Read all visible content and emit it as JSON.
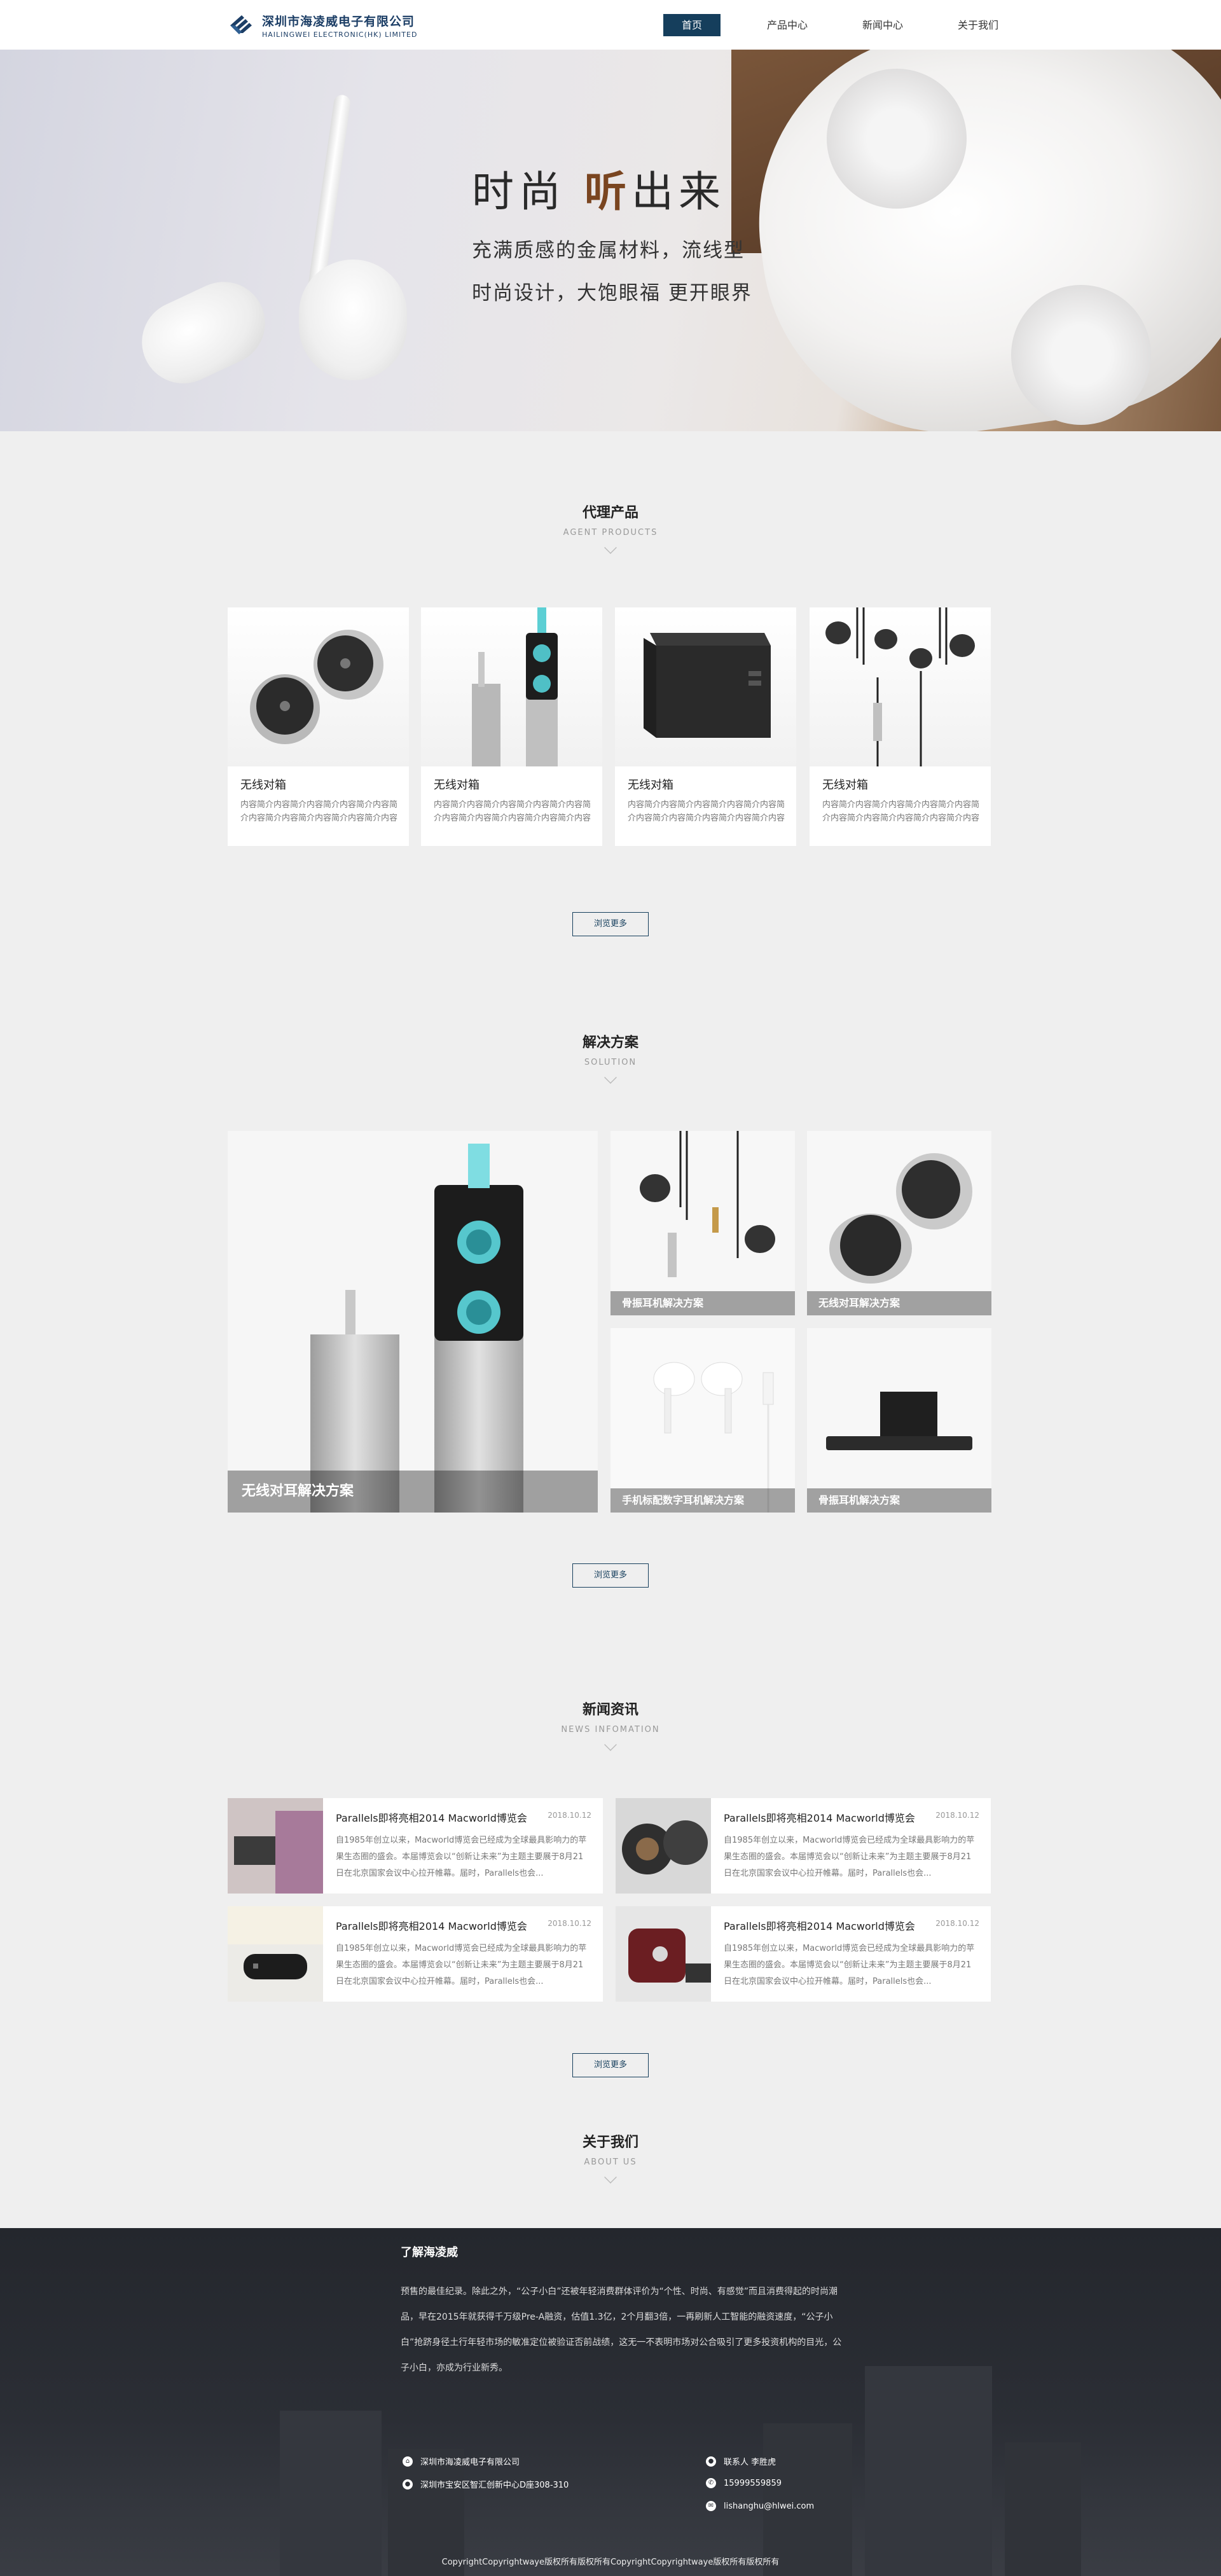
{
  "header": {
    "logo_cn": "深圳市海凌威电子有限公司",
    "logo_en": "HAILINGWEI ELECTRONIC(HK) LIMITED",
    "nav": [
      "首页",
      "产品中心",
      "新闻中心",
      "关于我们"
    ]
  },
  "hero": {
    "title_pre": "时尚",
    "title_accent": "听",
    "title_post": "出来",
    "sub1": "充满质感的金属材料，流线型",
    "sub2": "时尚设计，大饱眼福  更开眼界"
  },
  "products": {
    "title": "代理产品",
    "en": "AGENT PRODUCTS",
    "items": [
      {
        "title": "无线对箱",
        "desc": "内容简介内容简介内容简介内容简介内容简介内容简介内容简介内容简介内容简介内容简介内容简介内容..."
      },
      {
        "title": "无线对箱",
        "desc": "内容简介内容简介内容简介内容简介内容简介内容简介内容简介内容简介内容简介内容简介内容简介内容..."
      },
      {
        "title": "无线对箱",
        "desc": "内容简介内容简介内容简介内容简介内容简介内容简介内容简介内容简介内容简介内容简介内容简介内容..."
      },
      {
        "title": "无线对箱",
        "desc": "内容简介内容简介内容简介内容简介内容简介内容简介内容简介内容简介内容简介内容简介内容简介内容..."
      }
    ],
    "more": "浏览更多"
  },
  "solutions": {
    "title": "解决方案",
    "en": "SOLUTION",
    "items": [
      "无线对耳解决方案",
      "骨振耳机解决方案",
      "无线对耳解决方案",
      "手机标配数字耳机解决方案",
      "骨振耳机解决方案"
    ],
    "more": "浏览更多"
  },
  "news": {
    "title": "新闻资讯",
    "en": "NEWS INFOMATION",
    "items": [
      {
        "title": "Parallels即将亮相2014 Macworld博览会",
        "date": "2018.10.12",
        "desc": "自1985年创立以来，Macworld博览会已经成为全球最具影响力的苹果生态圈的盛会。本届博览会以“创新让未来”为主题主要展于8月21日在北京国家会议中心拉开帷幕。届时，Parallels也会..."
      },
      {
        "title": "Parallels即将亮相2014 Macworld博览会",
        "date": "2018.10.12",
        "desc": "自1985年创立以来，Macworld博览会已经成为全球最具影响力的苹果生态圈的盛会。本届博览会以“创新让未来”为主题主要展于8月21日在北京国家会议中心拉开帷幕。届时，Parallels也会..."
      },
      {
        "title": "Parallels即将亮相2014 Macworld博览会",
        "date": "2018.10.12",
        "desc": "自1985年创立以来，Macworld博览会已经成为全球最具影响力的苹果生态圈的盛会。本届博览会以“创新让未来”为主题主要展于8月21日在北京国家会议中心拉开帷幕。届时，Parallels也会..."
      },
      {
        "title": "Parallels即将亮相2014 Macworld博览会",
        "date": "2018.10.12",
        "desc": "自1985年创立以来，Macworld博览会已经成为全球最具影响力的苹果生态圈的盛会。本届博览会以“创新让未来”为主题主要展于8月21日在北京国家会议中心拉开帷幕。届时，Parallels也会..."
      }
    ],
    "more": "浏览更多"
  },
  "about": {
    "title": "关于我们",
    "en": "ABOUT US"
  },
  "footer": {
    "title": "了解海凌威",
    "text": "预售的最佳纪录。除此之外，“公子小白”还被年轻消费群体评价为“个性、时尚、有感觉”而且消费得起的时尚潮品，早在2015年就获得千万级Pre-A融资，估值1.3亿，2个月翻3倍，一再刷新人工智能的融资速度，“公子小白”抢跻身径土行年轻市场的敏准定位被验证否前战绩，这无一不表明市场对公合吸引了更多投资机构的目光，公子小白，亦成为行业新秀。",
    "company": "深圳市海凌威电子有限公司",
    "address": "深圳市宝安区智汇创新中心D座308-310",
    "contact": "联系人 李胜虎",
    "phone": "15999559859",
    "email": "lishanghu@hlwei.com",
    "copyright": "CopyrightCopyrightwaye版权所有版权所有CopyrightCopyrightwaye版权所有版权所有"
  }
}
